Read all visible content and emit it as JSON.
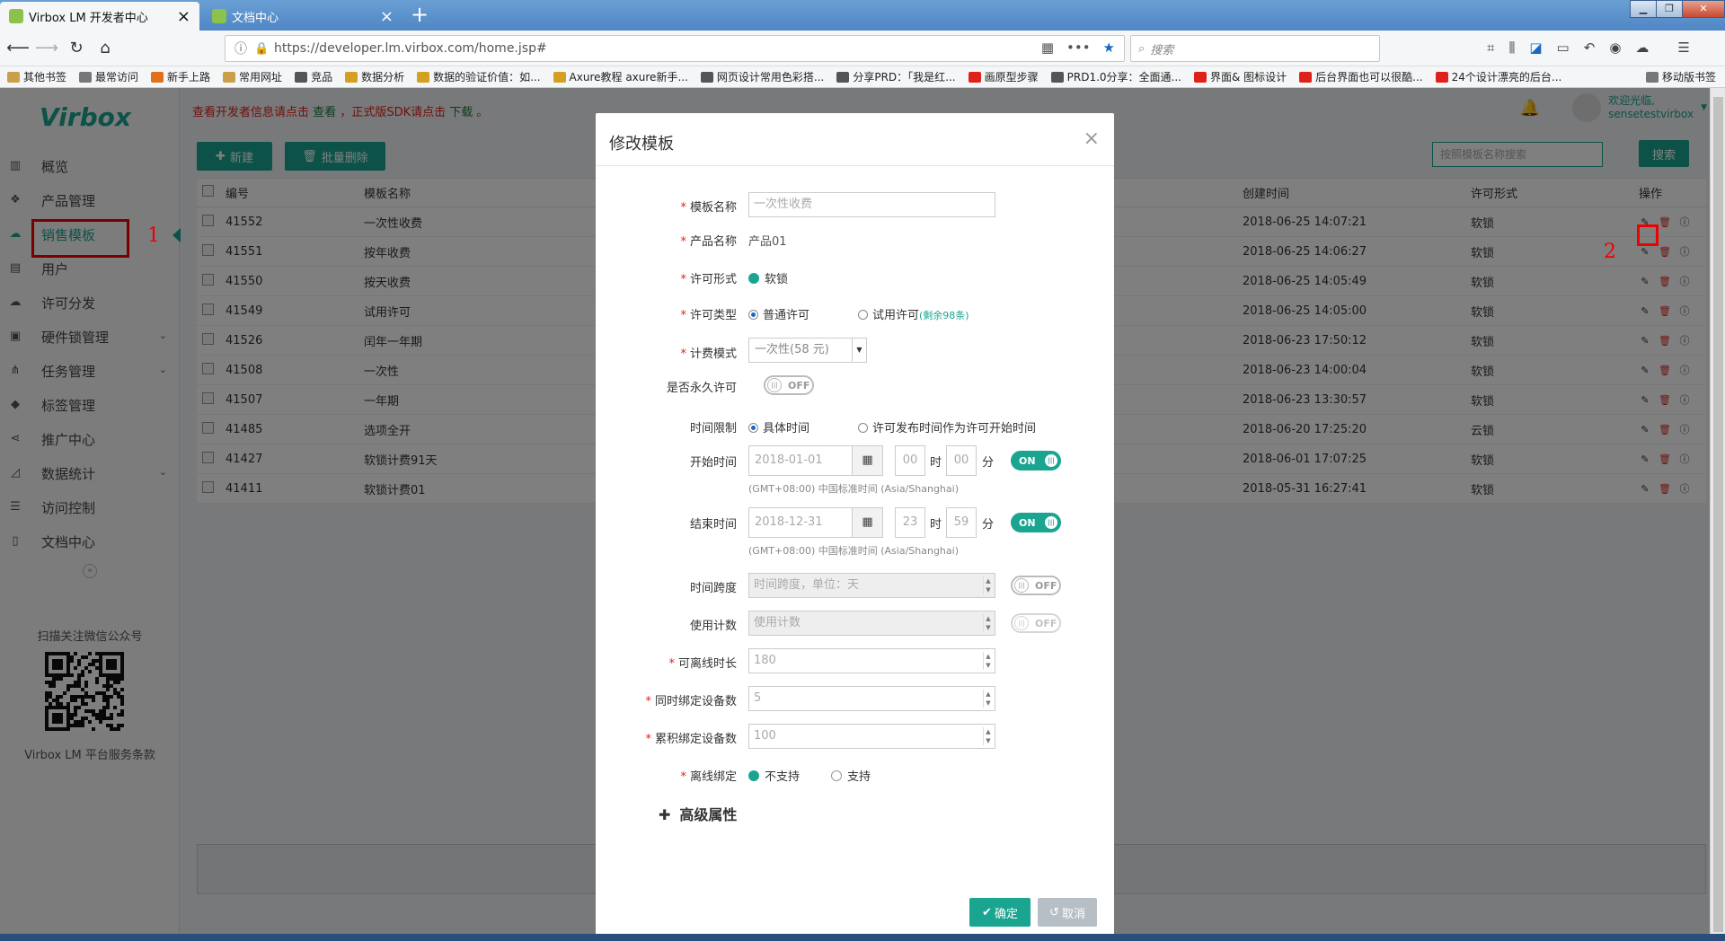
{
  "browser": {
    "tabs": [
      {
        "title": "Virbox LM 开发者中心",
        "active": true
      },
      {
        "title": "文档中心",
        "active": false
      }
    ],
    "url": "https://developer.lm.virbox.com/home.jsp#",
    "search_placeholder": "搜索",
    "bookmarks": [
      "其他书签",
      "最常访问",
      "新手上路",
      "常用网址",
      "竞品",
      "数据分析",
      "数据的验证价值：如...",
      "Axure教程 axure新手...",
      "网页设计常用色彩搭...",
      "分享PRD：「我是红...",
      "画原型步骤",
      "PRD1.0分享：全面通...",
      "界面& 图标设计",
      "后台界面也可以很酷...",
      "24个设计漂亮的后台...",
      "移动版书签"
    ]
  },
  "sidebar": {
    "logo": "Virbox",
    "items": [
      {
        "label": "概览",
        "icon": "bar-chart-icon",
        "arrow": false
      },
      {
        "label": "产品管理",
        "icon": "cubes-icon",
        "arrow": false
      },
      {
        "label": "销售模板",
        "icon": "cloud-icon",
        "arrow": false,
        "active": true
      },
      {
        "label": "用户",
        "icon": "id-card-icon",
        "arrow": false
      },
      {
        "label": "许可分发",
        "icon": "cloud-upload-icon",
        "arrow": false
      },
      {
        "label": "硬件锁管理",
        "icon": "lock-icon",
        "arrow": true
      },
      {
        "label": "任务管理",
        "icon": "sitemap-icon",
        "arrow": true
      },
      {
        "label": "标签管理",
        "icon": "tag-icon",
        "arrow": false
      },
      {
        "label": "推广中心",
        "icon": "share-icon",
        "arrow": false
      },
      {
        "label": "数据统计",
        "icon": "area-chart-icon",
        "arrow": true
      },
      {
        "label": "访问控制",
        "icon": "sliders-icon",
        "arrow": false
      },
      {
        "label": "文档中心",
        "icon": "document-icon",
        "arrow": false
      }
    ],
    "annotation_1": "1",
    "qr_title": "扫描关注微信公众号",
    "terms": "Virbox LM 平台服务条款"
  },
  "main": {
    "notice_prefix": "查看开发者信息请点击",
    "notice_link1": "查看",
    "notice_mid": "，正式版SDK请点击",
    "notice_link2": "下载",
    "notice_suffix": "。",
    "welcome": "欢迎光临,",
    "username": "sensetestvirbox",
    "new_button": "新建",
    "batch_delete_button": "批量删除",
    "search_placeholder": "按照模板名称搜索",
    "search_button": "搜索",
    "annotation_2": "2",
    "columns": {
      "id": "编号",
      "name": "模板名称",
      "created": "创建时间",
      "license": "许可形式",
      "ops": "操作"
    },
    "rows": [
      {
        "id": "41552",
        "name": "一次性收费",
        "created": "2018-06-25 14:07:21",
        "license": "软锁"
      },
      {
        "id": "41551",
        "name": "按年收费",
        "created": "2018-06-25 14:06:27",
        "license": "软锁"
      },
      {
        "id": "41550",
        "name": "按天收费",
        "created": "2018-06-25 14:05:49",
        "license": "软锁"
      },
      {
        "id": "41549",
        "name": "试用许可",
        "created": "2018-06-25 14:05:00",
        "license": "软锁"
      },
      {
        "id": "41526",
        "name": "闰年一年期",
        "created": "2018-06-23 17:50:12",
        "license": "软锁"
      },
      {
        "id": "41508",
        "name": "一次性",
        "created": "2018-06-23 14:00:04",
        "license": "软锁"
      },
      {
        "id": "41507",
        "name": "一年期",
        "created": "2018-06-23 13:30:57",
        "license": "软锁"
      },
      {
        "id": "41485",
        "name": "选项全开",
        "created": "2018-06-20 17:25:20",
        "license": "云锁"
      },
      {
        "id": "41427",
        "name": "软锁计费91天",
        "created": "2018-06-01 17:07:25",
        "license": "软锁"
      },
      {
        "id": "41411",
        "name": "软锁计费01",
        "created": "2018-05-31 16:27:41",
        "license": "软锁"
      }
    ]
  },
  "modal": {
    "title": "修改模板",
    "template_name_label": "模板名称",
    "template_name_value": "一次性收费",
    "product_name_label": "产品名称",
    "product_name_value": "产品01",
    "license_form_label": "许可形式",
    "license_form_value": "软锁",
    "license_type_label": "许可类型",
    "license_type_opt1": "普通许可",
    "license_type_opt2": "试用许可",
    "license_type_remaining": "(剩余98条)",
    "billing_label": "计费模式",
    "billing_value": "一次性(58 元)",
    "permanent_label": "是否永久许可",
    "toggle_off": "OFF",
    "toggle_on": "ON",
    "time_limit_label": "时间限制",
    "time_limit_opt1": "具体时间",
    "time_limit_opt2": "许可发布时间作为许可开始时间",
    "start_label": "开始时间",
    "start_date": "2018-01-01",
    "start_hour": "00",
    "start_min": "00",
    "hour_unit": "时",
    "min_unit": "分",
    "timezone": "(GMT+08:00) 中国标准时间 (Asia/Shanghai)",
    "end_label": "结束时间",
    "end_date": "2018-12-31",
    "end_hour": "23",
    "end_min": "59",
    "span_label": "时间跨度",
    "span_placeholder": "时间跨度，单位：天",
    "count_label": "使用计数",
    "count_placeholder": "使用计数",
    "offline_duration_label": "可离线时长",
    "offline_duration_value": "180",
    "concurrent_label": "同时绑定设备数",
    "concurrent_value": "5",
    "cumulative_label": "累积绑定设备数",
    "cumulative_value": "100",
    "offline_bind_label": "离线绑定",
    "offline_bind_opt1": "不支持",
    "offline_bind_opt2": "支持",
    "advanced": "高级属性",
    "confirm": "确定",
    "cancel": "取消"
  },
  "colors": {
    "accent": "#1aa591",
    "danger": "#e0211b"
  }
}
